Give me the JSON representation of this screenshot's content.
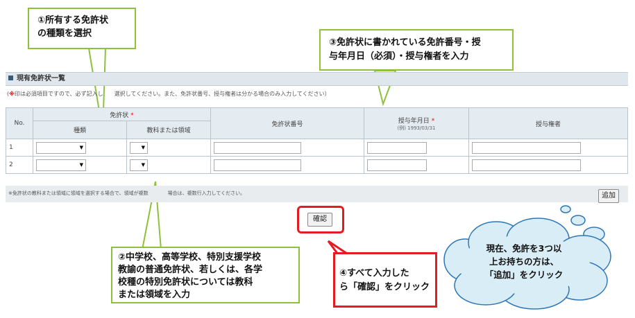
{
  "section": {
    "title": "現有免許状一覧"
  },
  "notes": {
    "required_prefix": "(",
    "required_mark": "※",
    "required_text": "印は必須項目ですので、必ず記入し　　選択してください。また、免許状番号、授与権者は分かる場合のみ入力してください）",
    "footer": "※免許状の教科または領域に領域を選択する場合で、領域が複数　　　　場合は、複数行入力してください。"
  },
  "table": {
    "no_header": "No.",
    "license_header": "免許状",
    "type_header": "種類",
    "subject_header": "教科または領域",
    "number_header": "免許状番号",
    "date_header": "授与年月日",
    "date_example": "(例) 1993/03/31",
    "authority_header": "授与権者",
    "required_star": "*",
    "rows": [
      {
        "no": "1"
      },
      {
        "no": "2"
      }
    ]
  },
  "buttons": {
    "add": "追加",
    "confirm": "確認"
  },
  "callouts": {
    "c1": {
      "line1": "①所有する免許状",
      "line2": "の種類を選択"
    },
    "c3": {
      "line1": "③免許状に書かれている免許番号・授",
      "line2": "与年月日（必須）・授与権者を入力"
    },
    "c2": {
      "line1": "②中学校、高等学校、特別支援学校",
      "line2": "教諭の普通免許状、若しくは、各学",
      "line3": "校種の特別免許状については教科",
      "line4": "または領域を入力"
    },
    "c4": {
      "line1": "④すべて入力した",
      "line2": "ら「確認」をクリック"
    },
    "cloud": {
      "line1": "現在、免許を3つ以",
      "line2": "上お持ちの方は、",
      "line3": "「追加」をクリック"
    }
  },
  "colors": {
    "callout_border": "#8dc13a",
    "highlight": "#e31b23",
    "cloud_fill": "#d9edf7",
    "cloud_border": "#2e75b6"
  }
}
